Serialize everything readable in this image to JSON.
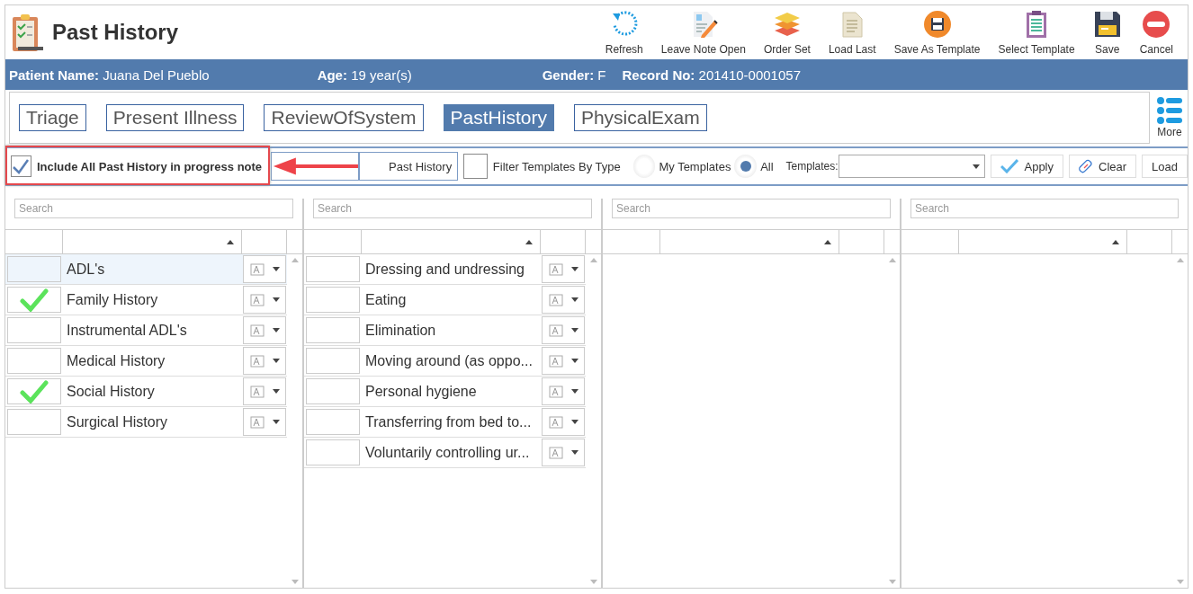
{
  "window": {
    "title": "Past History"
  },
  "toolbar": [
    {
      "label": "Refresh",
      "kind": "refresh"
    },
    {
      "label": "Leave Note Open",
      "kind": "note"
    },
    {
      "label": "Order Set",
      "kind": "layers"
    },
    {
      "label": "Load Last",
      "kind": "document"
    },
    {
      "label": "Save As Template",
      "kind": "template-save"
    },
    {
      "label": "Select Template",
      "kind": "clipboard"
    },
    {
      "label": "Save",
      "kind": "save"
    },
    {
      "label": "Cancel",
      "kind": "cancel"
    }
  ],
  "patient": [
    {
      "label": "Patient Name:",
      "value": "Juana Del Pueblo"
    },
    {
      "label": "Age:",
      "value": "19 year(s)"
    },
    {
      "label": "Gender:",
      "value": "F"
    },
    {
      "label": "Record No:",
      "value": "201410-0001057"
    }
  ],
  "tabs": [
    {
      "label": "Triage",
      "selected": false
    },
    {
      "label": "Present Illness",
      "selected": false
    },
    {
      "label": "ReviewOfSystem",
      "selected": false
    },
    {
      "label": "PastHistory",
      "selected": true
    },
    {
      "label": "PhysicalExam",
      "selected": false
    }
  ],
  "more": {
    "label": "More"
  },
  "options": {
    "include_all": {
      "label": "Include All Past History in progress note",
      "checked": true
    },
    "past_history_button": {
      "label": "Past History"
    },
    "filter_by_type": {
      "label": "Filter Templates By Type",
      "checked": false
    },
    "radios": [
      {
        "label": "My Templates",
        "selected": false
      },
      {
        "label": "All",
        "selected": true
      }
    ],
    "templates_label": "Templates:",
    "buttons": [
      {
        "label": "Apply",
        "kind": "apply"
      },
      {
        "label": "Clear",
        "kind": "clear"
      },
      {
        "label": "Load",
        "kind": "plain"
      }
    ]
  },
  "panels": [
    {
      "search": {
        "placeholder": "Search"
      },
      "rows": [
        {
          "label": "ADL's",
          "checked": false,
          "selected": true
        },
        {
          "label": "Family History",
          "checked": true,
          "selected": false
        },
        {
          "label": "Instrumental ADL's",
          "checked": false,
          "selected": false
        },
        {
          "label": "Medical History",
          "checked": false,
          "selected": false
        },
        {
          "label": "Social History",
          "checked": true,
          "selected": false
        },
        {
          "label": "Surgical History",
          "checked": false,
          "selected": false
        }
      ]
    },
    {
      "search": {
        "placeholder": "Search"
      },
      "rows": [
        {
          "label": "Dressing and undressing",
          "checked": false,
          "selected": false
        },
        {
          "label": "Eating",
          "checked": false,
          "selected": false
        },
        {
          "label": "Elimination",
          "checked": false,
          "selected": false
        },
        {
          "label": "Moving around (as oppo...",
          "checked": false,
          "selected": false
        },
        {
          "label": "Personal hygiene",
          "checked": false,
          "selected": false
        },
        {
          "label": "Transferring from bed to...",
          "checked": false,
          "selected": false
        },
        {
          "label": "Voluntarily controlling ur...",
          "checked": false,
          "selected": false
        }
      ]
    },
    {
      "search": {
        "placeholder": "Search"
      }
    },
    {
      "search": {
        "placeholder": "Search"
      }
    }
  ]
}
